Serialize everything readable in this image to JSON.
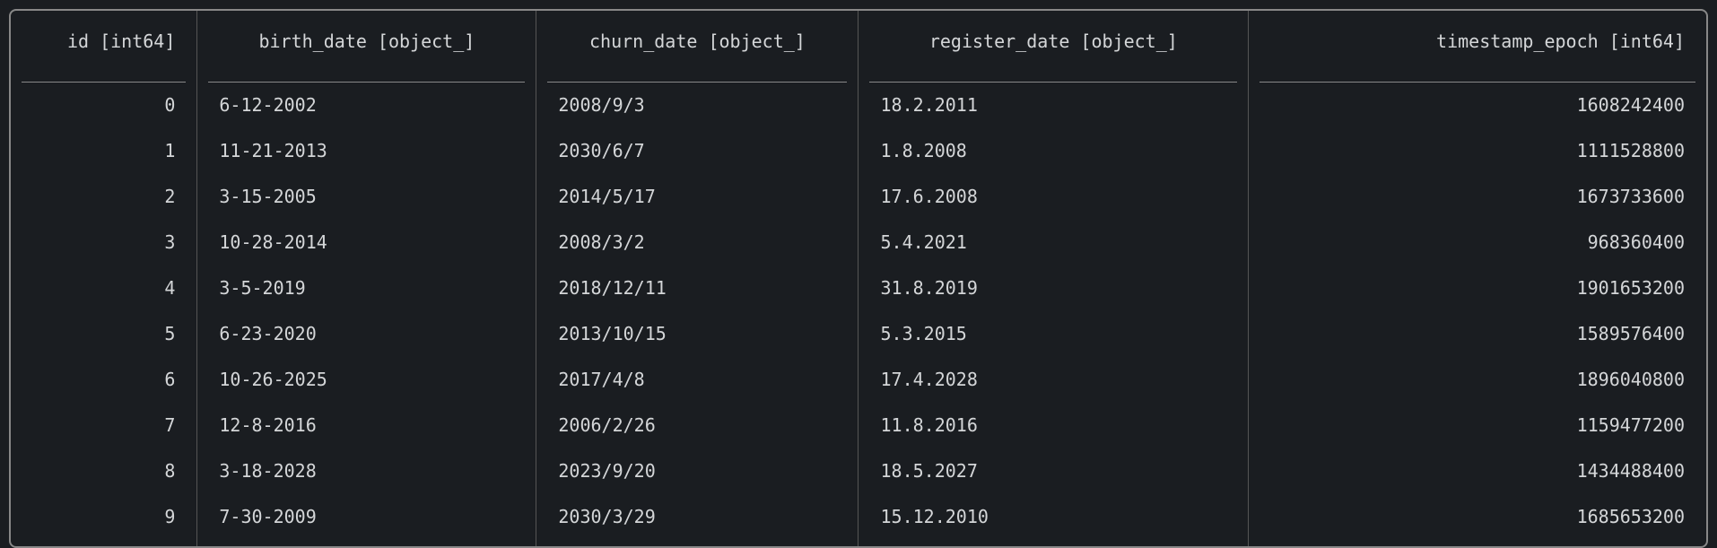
{
  "columns": [
    {
      "key": "id",
      "label": "id [int64]",
      "class": "col-id"
    },
    {
      "key": "birth_date",
      "label": "birth_date [object_]",
      "class": "col-birth"
    },
    {
      "key": "churn_date",
      "label": "churn_date [object_]",
      "class": "col-churn"
    },
    {
      "key": "register_date",
      "label": "register_date [object_]",
      "class": "col-register"
    },
    {
      "key": "timestamp_epoch",
      "label": "timestamp_epoch [int64]",
      "class": "col-timestamp"
    }
  ],
  "rows": [
    {
      "id": "0",
      "birth_date": "6-12-2002",
      "churn_date": "2008/9/3",
      "register_date": "18.2.2011",
      "timestamp_epoch": "1608242400"
    },
    {
      "id": "1",
      "birth_date": "11-21-2013",
      "churn_date": "2030/6/7",
      "register_date": "1.8.2008",
      "timestamp_epoch": "1111528800"
    },
    {
      "id": "2",
      "birth_date": "3-15-2005",
      "churn_date": "2014/5/17",
      "register_date": "17.6.2008",
      "timestamp_epoch": "1673733600"
    },
    {
      "id": "3",
      "birth_date": "10-28-2014",
      "churn_date": "2008/3/2",
      "register_date": "5.4.2021",
      "timestamp_epoch": "968360400"
    },
    {
      "id": "4",
      "birth_date": "3-5-2019",
      "churn_date": "2018/12/11",
      "register_date": "31.8.2019",
      "timestamp_epoch": "1901653200"
    },
    {
      "id": "5",
      "birth_date": "6-23-2020",
      "churn_date": "2013/10/15",
      "register_date": "5.3.2015",
      "timestamp_epoch": "1589576400"
    },
    {
      "id": "6",
      "birth_date": "10-26-2025",
      "churn_date": "2017/4/8",
      "register_date": "17.4.2028",
      "timestamp_epoch": "1896040800"
    },
    {
      "id": "7",
      "birth_date": "12-8-2016",
      "churn_date": "2006/2/26",
      "register_date": "11.8.2016",
      "timestamp_epoch": "1159477200"
    },
    {
      "id": "8",
      "birth_date": "3-18-2028",
      "churn_date": "2023/9/20",
      "register_date": "18.5.2027",
      "timestamp_epoch": "1434488400"
    },
    {
      "id": "9",
      "birth_date": "7-30-2009",
      "churn_date": "2030/3/29",
      "register_date": "15.12.2010",
      "timestamp_epoch": "1685653200"
    }
  ]
}
